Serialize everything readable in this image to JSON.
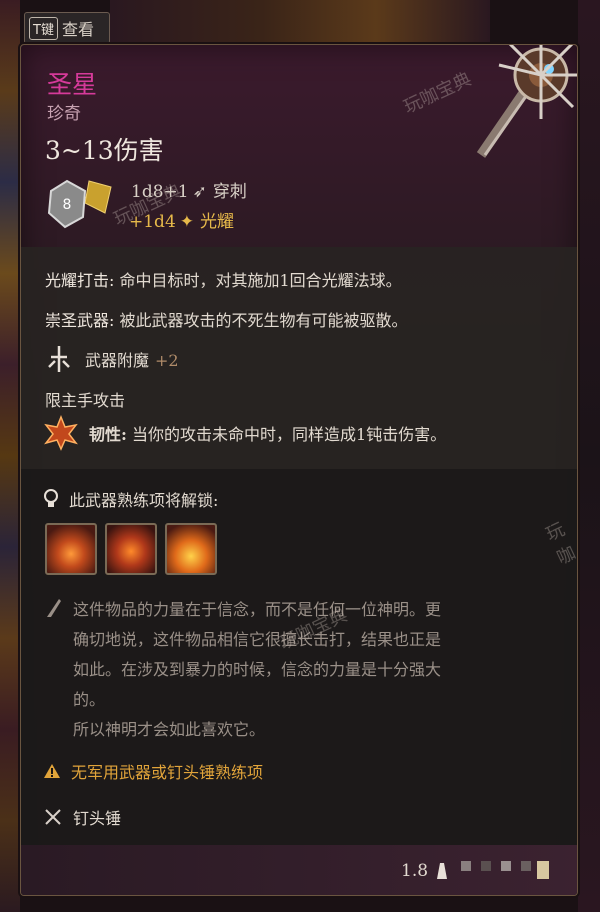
{
  "hotkey": {
    "key": "T键",
    "label": "查看"
  },
  "item": {
    "name": "圣星",
    "rarity": "珍奇",
    "damage_range": "3~13伤害",
    "dice_value": "8",
    "damage_line_1": {
      "dice": "1d8+1",
      "type": "穿刺"
    },
    "damage_line_2": {
      "dice": "+1d4",
      "type": "光耀"
    }
  },
  "properties": {
    "radiant_strike": {
      "name": "光耀打击:",
      "text": "命中目标时，对其施加1回合光耀法球。"
    },
    "holy_weapon": {
      "name": "崇圣武器:",
      "text": "被此武器攻击的不死生物有可能被驱散。"
    },
    "enchant": {
      "name": "武器附魔",
      "bonus": "+2"
    },
    "main_hand": "限主手攻击",
    "toughness": {
      "name": "韧性:",
      "text": "当你的攻击未命中时，同样造成1钝击伤害。"
    }
  },
  "proficiency": {
    "header": "此武器熟练项将解锁:"
  },
  "flavor": [
    "这件物品的力量在于信念，而不是任何一位神明。更",
    "确切地说，这件物品相信它很擅长击打，结果也正是",
    "如此。在涉及到暴力的时候，信念的力量是十分强大",
    "的。",
    "所以神明才会如此喜欢它。"
  ],
  "warning": "无军用武器或钉头锤熟练项",
  "weapon_type": "钉头锤",
  "weight": "1.8",
  "watermarks": [
    "玩咖宝典",
    "玩咖宝典",
    "玩咖宝典",
    "玩咖"
  ],
  "colors": {
    "title": "#d63a9a",
    "warning": "#e1a43a",
    "radiant": "#e6b94a"
  }
}
